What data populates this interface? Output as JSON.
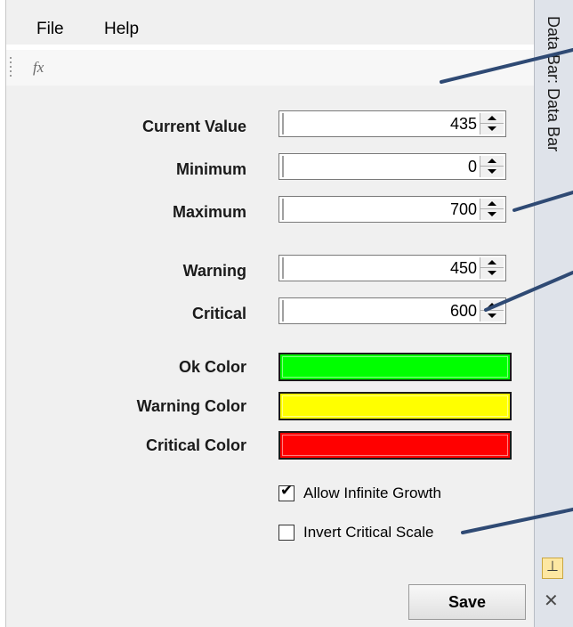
{
  "menu": {
    "file": "File",
    "help": "Help"
  },
  "formula": {
    "fx": "fx"
  },
  "fields": [
    {
      "label": "Current Value",
      "value": "435"
    },
    {
      "label": "Minimum",
      "value": "0"
    },
    {
      "label": "Maximum",
      "value": "700"
    },
    {
      "label": "Warning",
      "value": "450"
    },
    {
      "label": "Critical",
      "value": "600"
    }
  ],
  "colors": [
    {
      "label": "Ok Color",
      "hex": "#00ff00"
    },
    {
      "label": "Warning Color",
      "hex": "#ffff00"
    },
    {
      "label": "Critical Color",
      "hex": "#ff0000"
    }
  ],
  "options": {
    "allow_infinite_growth": {
      "label": "Allow Infinite Growth",
      "checked": true
    },
    "invert_critical_scale": {
      "label": "Invert Critical Scale",
      "checked": false
    }
  },
  "buttons": {
    "save": "Save"
  },
  "side_panel": {
    "tab_text": "Data Bar: Data Bar"
  },
  "icons": {
    "pin": "pin-icon",
    "close": "close-icon",
    "grip": "grip-icon",
    "function": "function-icon"
  },
  "accent": {
    "callout_line": "#2f4a74",
    "pin_bg": "#fde7a2"
  }
}
